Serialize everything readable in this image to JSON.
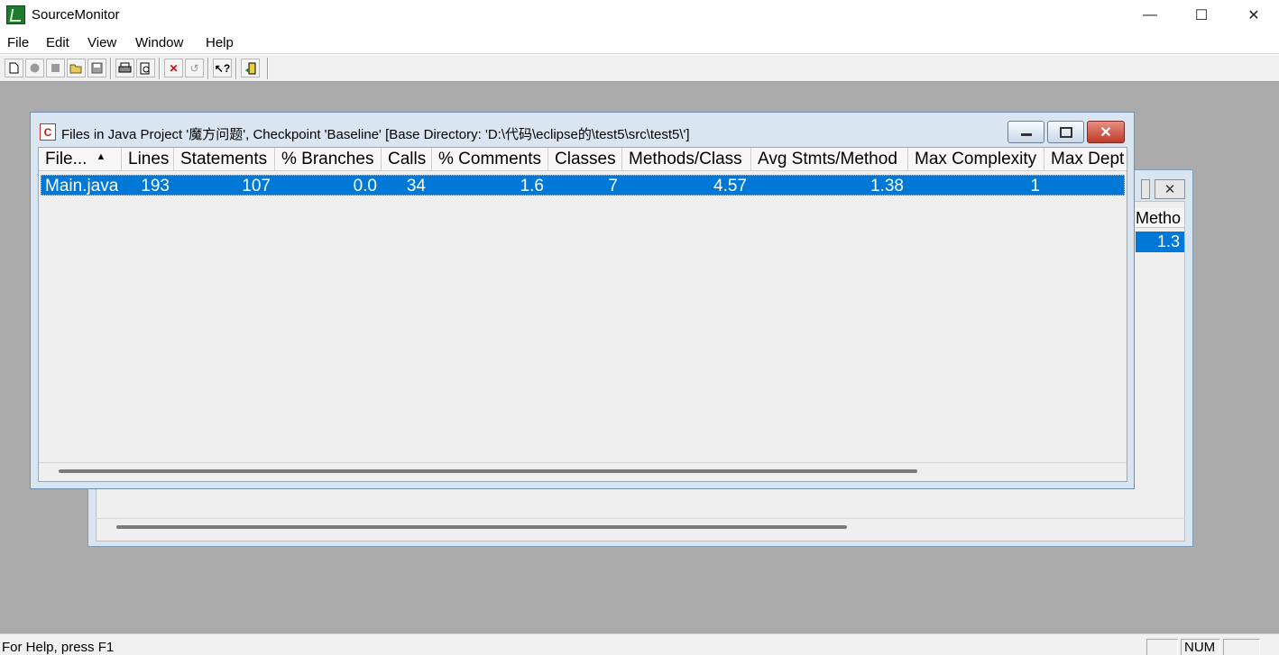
{
  "app": {
    "title": "SourceMonitor",
    "min_glyph": "—",
    "max_glyph": "☐",
    "close_glyph": "✕"
  },
  "menu": [
    "File",
    "Edit",
    "View",
    "Window",
    "Help"
  ],
  "toolbar_icons": [
    "new-file-icon",
    "tool-gray-icon",
    "tool-gray-2-icon",
    "open-folder-icon",
    "save-icon",
    "print-icon",
    "print-preview-icon",
    "delete-icon",
    "undo-icon",
    "help-pointer-icon",
    "exit-icon"
  ],
  "front_window": {
    "title": "Files in Java Project '魔方问题', Checkpoint 'Baseline'  [Base Directory: 'D:\\代码\\eclipse的\\test5\\src\\test5\\']",
    "icon_letter": "C",
    "columns": [
      "File...",
      "Lines",
      "Statements",
      "% Branches",
      "Calls",
      "% Comments",
      "Classes",
      "Methods/Class",
      "Avg Stmts/Method",
      "Max Complexity",
      "Max Dept"
    ],
    "sort_glyph": "▲",
    "rows": [
      [
        "Main.java",
        "193",
        "107",
        "0.0",
        "34",
        "1.6",
        "7",
        "4.57",
        "1.38",
        "1",
        ""
      ]
    ]
  },
  "back_window": {
    "header_fragment": "Metho",
    "value_fragment": "1.3"
  },
  "status": {
    "text": "For Help, press F1",
    "num": "NUM"
  }
}
